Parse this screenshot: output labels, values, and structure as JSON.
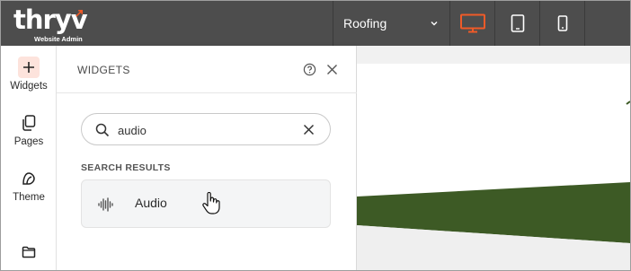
{
  "brand": {
    "name": "thryv",
    "subtitle": "Website Admin"
  },
  "topbar": {
    "page_selector": "Roofing",
    "devices": [
      {
        "name": "desktop",
        "active": true
      },
      {
        "name": "tablet",
        "active": false
      },
      {
        "name": "mobile",
        "active": false
      }
    ],
    "colors": {
      "bar": "#4d4d4d",
      "active_device": "#f05a28"
    }
  },
  "rail": {
    "items": [
      {
        "label": "Widgets",
        "icon": "plus-icon",
        "active": true
      },
      {
        "label": "Pages",
        "icon": "pages-icon"
      },
      {
        "label": "Theme",
        "icon": "theme-icon"
      },
      {
        "label": "",
        "icon": "folder-icon"
      }
    ]
  },
  "panel": {
    "title": "WIDGETS",
    "search": {
      "value": "audio",
      "placeholder": ""
    },
    "results_label": "SEARCH RESULTS",
    "results": [
      {
        "label": "Audio",
        "icon": "audio-waveform-icon"
      }
    ]
  }
}
